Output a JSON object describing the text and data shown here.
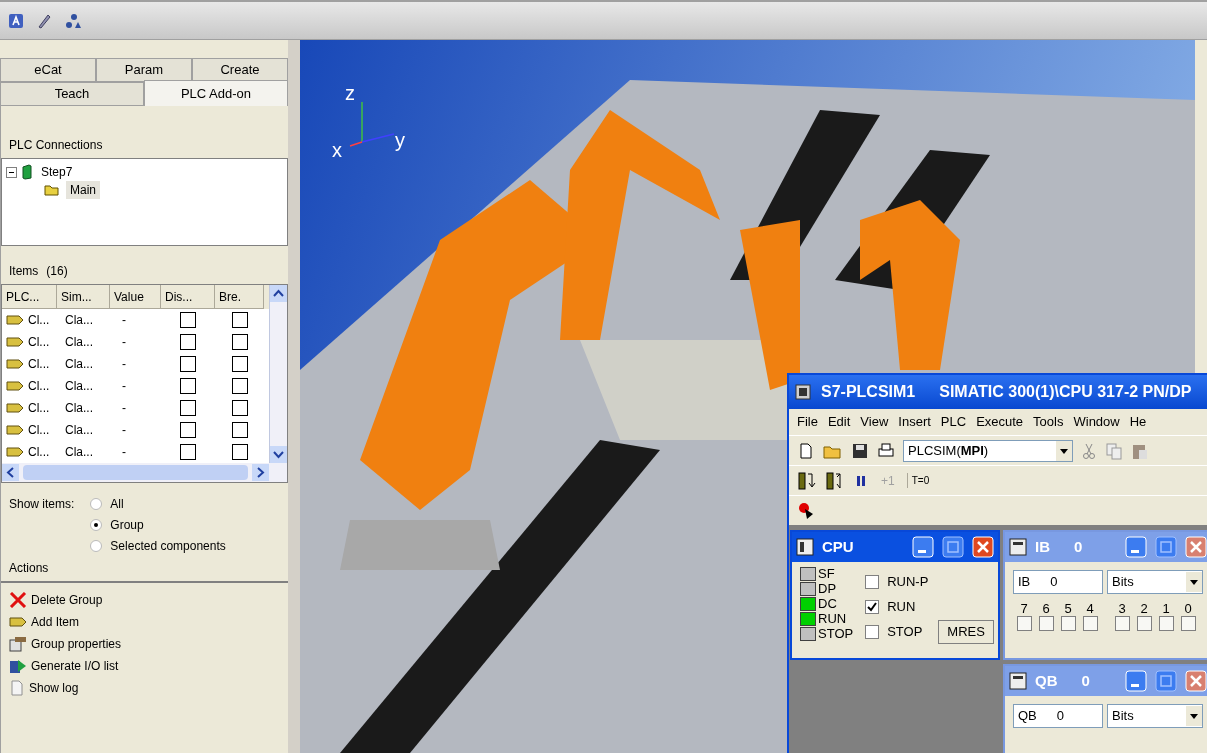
{
  "tab_rows": [
    [
      {
        "label": "eCat",
        "selected": false
      },
      {
        "label": "Param",
        "selected": false
      },
      {
        "label": "Create",
        "selected": false
      }
    ],
    [
      {
        "label": "Teach",
        "selected": false
      },
      {
        "label": "PLC Add-on",
        "selected": true
      }
    ]
  ],
  "connections": {
    "title": "PLC Connections",
    "tree": [
      {
        "label": "Step7",
        "expanded": true,
        "selected": false,
        "children": [
          {
            "label": "Main",
            "selected": true
          }
        ]
      }
    ]
  },
  "items": {
    "title": "Items",
    "count": "(16)",
    "columns": [
      "PLC...",
      "Sim...",
      "Value",
      "Dis...",
      "Bre."
    ],
    "rows": [
      {
        "plc": "Cl...",
        "sim": "Cla...",
        "value": "-",
        "dis": false,
        "bre": false
      },
      {
        "plc": "Cl...",
        "sim": "Cla...",
        "value": "-",
        "dis": false,
        "bre": false
      },
      {
        "plc": "Cl...",
        "sim": "Cla...",
        "value": "-",
        "dis": false,
        "bre": false
      },
      {
        "plc": "Cl...",
        "sim": "Cla...",
        "value": "-",
        "dis": false,
        "bre": false
      },
      {
        "plc": "Cl...",
        "sim": "Cla...",
        "value": "-",
        "dis": false,
        "bre": false
      },
      {
        "plc": "Cl...",
        "sim": "Cla...",
        "value": "-",
        "dis": false,
        "bre": false
      },
      {
        "plc": "Cl...",
        "sim": "Cla...",
        "value": "-",
        "dis": false,
        "bre": false
      }
    ]
  },
  "show_items": {
    "label": "Show items:",
    "options": [
      {
        "label": "All",
        "selected": false
      },
      {
        "label": "Group",
        "selected": true
      },
      {
        "label": "Selected components",
        "selected": false
      }
    ]
  },
  "actions": {
    "title": "Actions",
    "items": [
      {
        "kind": "delete",
        "label": "Delete Group"
      },
      {
        "kind": "tag",
        "label": "Add Item"
      },
      {
        "kind": "properties",
        "label": "Group properties"
      },
      {
        "kind": "generate",
        "label": "Generate I/O list"
      },
      {
        "kind": "log",
        "label": "Show log"
      }
    ]
  },
  "viewport": {
    "axes": {
      "z": "z",
      "x": "x",
      "y": "y"
    }
  },
  "plcsim": {
    "app": "S7-PLCSIM1",
    "cpu_path": "SIMATIC 300(1)\\CPU 317-2 PN/DP",
    "menu": [
      {
        "label": "File"
      },
      {
        "label": "Edit"
      },
      {
        "label": "View"
      },
      {
        "label": "Insert"
      },
      {
        "label": "PLC"
      },
      {
        "label": "Execute"
      },
      {
        "label": "Tools"
      },
      {
        "label": "Window"
      },
      {
        "label": "He"
      }
    ],
    "station": "PLCSIM(**MPI**)",
    "step": {
      "label": "+1",
      "disabled": true
    },
    "reset_timers": "T=0",
    "cpu": {
      "title": "CPU",
      "active": true,
      "leds": [
        {
          "label": "SF",
          "on": false
        },
        {
          "label": "DP",
          "on": false
        },
        {
          "label": "DC",
          "on": true
        },
        {
          "label": "RUN",
          "on": true
        },
        {
          "label": "STOP",
          "on": false
        }
      ],
      "modes": [
        {
          "label": "RUN-P",
          "checked": false
        },
        {
          "label": "RUN",
          "checked": true
        },
        {
          "label": "STOP",
          "checked": false
        }
      ],
      "reset": "MRES"
    },
    "ib": {
      "title": "IB",
      "number": "0",
      "active": false,
      "area": "IB",
      "address": "0",
      "format": "Bits",
      "bits": [
        {
          "label": "7",
          "checked": false
        },
        {
          "label": "6",
          "checked": false
        },
        {
          "label": "5",
          "checked": false
        },
        {
          "label": "4",
          "checked": false
        },
        {
          "label": "3",
          "checked": false
        },
        {
          "label": "2",
          "checked": false
        },
        {
          "label": "1",
          "checked": false
        },
        {
          "label": "0",
          "checked": false
        }
      ]
    },
    "qb": {
      "title": "QB",
      "number": "0",
      "active": false,
      "area": "QB",
      "address": "0",
      "format": "Bits"
    }
  }
}
